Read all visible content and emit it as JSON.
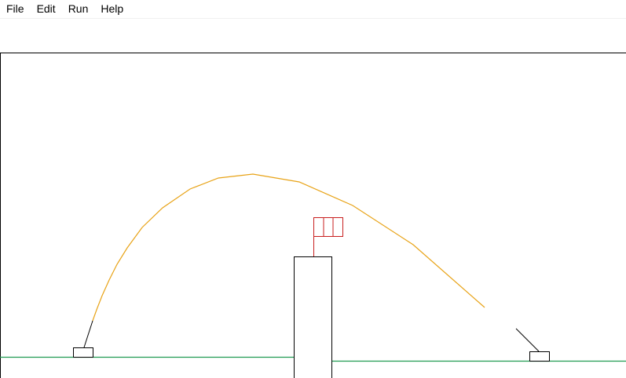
{
  "menu": {
    "items": [
      {
        "label": "File"
      },
      {
        "label": "Edit"
      },
      {
        "label": "Run"
      },
      {
        "label": "Help"
      }
    ]
  },
  "game": {
    "colors": {
      "frame": "#000000",
      "ground": "#1f9a50",
      "trajectory": "#e8a317",
      "flag": "#c81e1e",
      "tower": "#000000",
      "cannon": "#000000"
    }
  }
}
